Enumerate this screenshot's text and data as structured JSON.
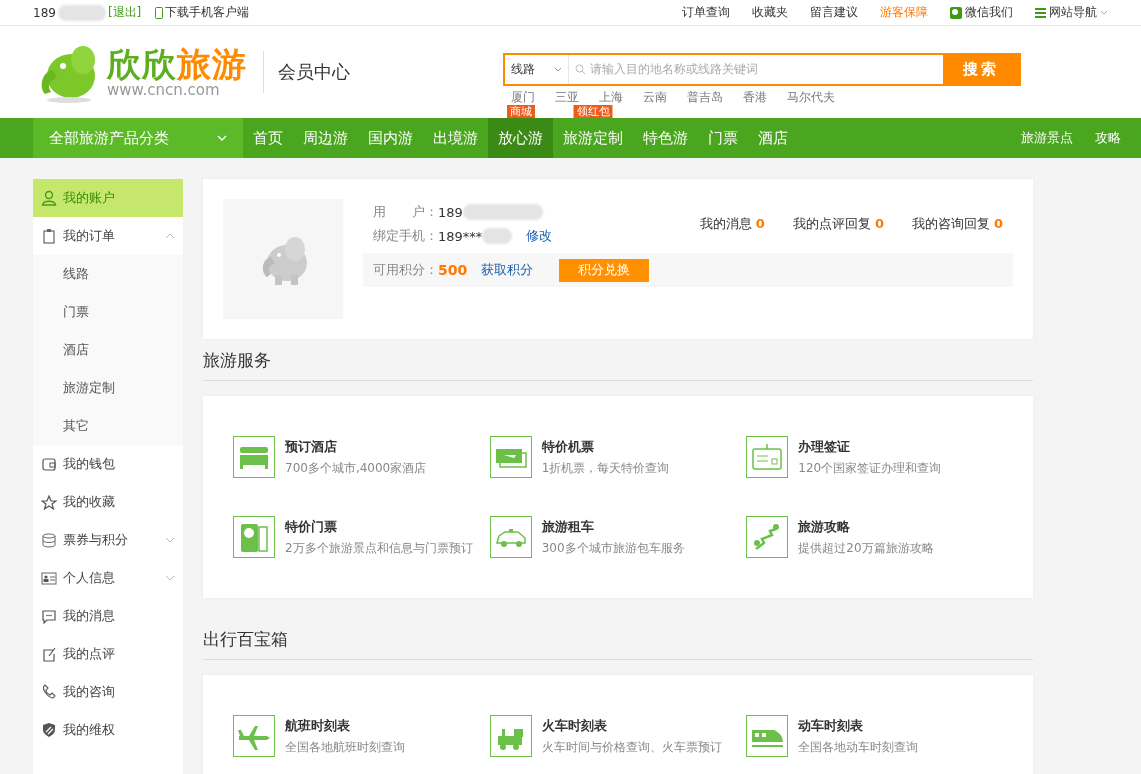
{
  "top_bar": {
    "user": "189",
    "logout": "[退出]",
    "app_download": "下载手机客户端",
    "links": [
      {
        "label": "订单查询",
        "highlighted": false
      },
      {
        "label": "收藏夹",
        "highlighted": false
      },
      {
        "label": "留言建议",
        "highlighted": false
      },
      {
        "label": "游客保障",
        "highlighted": true
      },
      {
        "label": "微信我们",
        "highlighted": false
      },
      {
        "label": "网站导航",
        "highlighted": false
      }
    ]
  },
  "header": {
    "logo": {
      "name_a": "欣欣",
      "name_b": "旅游",
      "url": "www.cncn.com"
    },
    "section": "会员中心",
    "search": {
      "type": "线路",
      "placeholder": "请输入目的地名称或线路关键词",
      "button": "搜索"
    },
    "hot_words": [
      "厦门",
      "三亚",
      "上海",
      "云南",
      "普吉岛",
      "香港",
      "马尔代夫"
    ]
  },
  "nav": {
    "category": "全部旅游产品分类",
    "items": [
      {
        "label": "首页",
        "selected": false
      },
      {
        "label": "周边游",
        "selected": false
      },
      {
        "label": "国内游",
        "selected": false
      },
      {
        "label": "出境游",
        "selected": false
      },
      {
        "label": "放心游",
        "selected": true,
        "badge": "商城"
      },
      {
        "label": "旅游定制",
        "selected": false,
        "badge": "领红包"
      },
      {
        "label": "特色游",
        "selected": false
      },
      {
        "label": "门票",
        "selected": false
      },
      {
        "label": "酒店",
        "selected": false
      }
    ],
    "side_links": [
      "旅游景点",
      "攻略"
    ]
  },
  "sidebar": {
    "items": [
      {
        "label": "我的账户",
        "selected": true
      },
      {
        "label": "我的订单",
        "selected": false,
        "expanded": true,
        "children": [
          {
            "label": "线路"
          },
          {
            "label": "门票"
          },
          {
            "label": "酒店"
          },
          {
            "label": "旅游定制"
          },
          {
            "label": "其它"
          }
        ]
      },
      {
        "label": "我的钱包",
        "selected": false
      },
      {
        "label": "我的收藏",
        "selected": false
      },
      {
        "label": "票券与积分",
        "selected": false,
        "expanded": false
      },
      {
        "label": "个人信息",
        "selected": false,
        "expanded": false
      },
      {
        "label": "我的消息",
        "selected": false
      },
      {
        "label": "我的点评",
        "selected": false
      },
      {
        "label": "我的咨询",
        "selected": false
      },
      {
        "label": "我的维权",
        "selected": false
      }
    ]
  },
  "profile": {
    "user_label": "用　　户：",
    "user_value": "189",
    "phone_label": "绑定手机：",
    "phone_value": "189***",
    "edit": "修改",
    "counters": [
      {
        "label": "我的消息",
        "value": "0"
      },
      {
        "label": "我的点评回复",
        "value": "0"
      },
      {
        "label": "我的咨询回复",
        "value": "0"
      }
    ],
    "points_label": "可用积分：",
    "points": "500",
    "earn": "获取积分",
    "exchange": "积分兑换"
  },
  "sections": [
    {
      "title": "旅游服务",
      "items": [
        {
          "title": "预订酒店",
          "desc": "700多个城市,4000家酒店"
        },
        {
          "title": "特价机票",
          "desc": "1折机票，每天特价查询"
        },
        {
          "title": "办理签证",
          "desc": "120个国家签证办理和查询"
        },
        {
          "title": "特价门票",
          "desc": "2万多个旅游景点和信息与门票预订"
        },
        {
          "title": "旅游租车",
          "desc": "300多个城市旅游包车服务"
        },
        {
          "title": "旅游攻略",
          "desc": "提供超过20万篇旅游攻略"
        }
      ]
    },
    {
      "title": "出行百宝箱",
      "items": [
        {
          "title": "航班时刻表",
          "desc": "全国各地航班时刻查询"
        },
        {
          "title": "火车时刻表",
          "desc": "火车时间与价格查询、火车票预订"
        },
        {
          "title": "动车时刻表",
          "desc": "全国各地动车时刻查询"
        }
      ]
    }
  ]
}
